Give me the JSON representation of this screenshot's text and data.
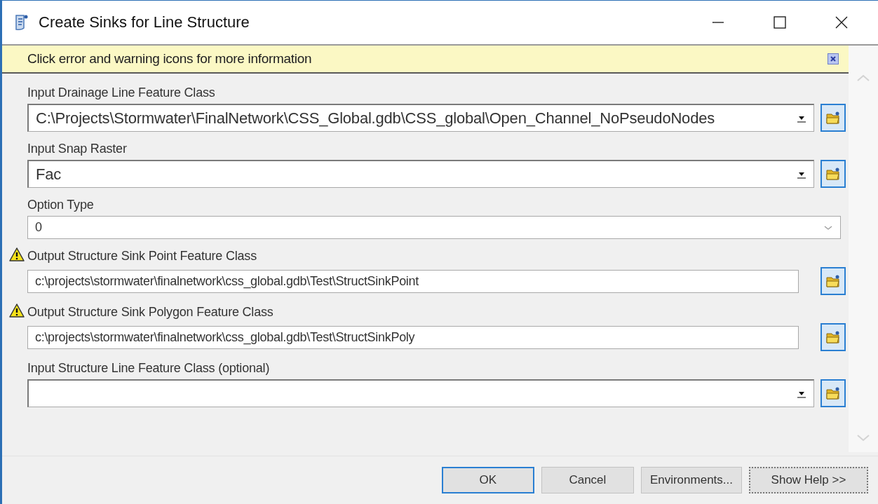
{
  "window": {
    "title": "Create Sinks for Line Structure"
  },
  "message_bar": {
    "text": "Click error and warning icons for more information"
  },
  "parameters": [
    {
      "label": "Input Drainage Line Feature Class",
      "value": "C:\\Projects\\Stormwater\\FinalNetwork\\CSS_Global.gdb\\CSS_global\\Open_Channel_NoPseudoNodes",
      "kind": "combo",
      "warning": false
    },
    {
      "label": "Input Snap Raster",
      "value": "Fac",
      "kind": "combo",
      "warning": false
    },
    {
      "label": "Option Type",
      "value": "0",
      "kind": "dropdown",
      "warning": false
    },
    {
      "label": "Output Structure Sink Point Feature Class",
      "value": "c:\\projects\\stormwater\\finalnetwork\\css_global.gdb\\Test\\StructSinkPoint",
      "kind": "text",
      "warning": true
    },
    {
      "label": "Output Structure Sink Polygon Feature Class",
      "value": "c:\\projects\\stormwater\\finalnetwork\\css_global.gdb\\Test\\StructSinkPoly",
      "kind": "text",
      "warning": true
    },
    {
      "label": "Input Structure  Line Feature Class (optional)",
      "kind": "combo",
      "warning": false
    }
  ],
  "buttons": [
    {
      "label": "OK",
      "kind": "default"
    },
    {
      "label": "Cancel",
      "kind": "normal"
    },
    {
      "label": "Environments...",
      "kind": "normal"
    },
    {
      "label": "Show Help >>",
      "kind": "focus"
    }
  ]
}
